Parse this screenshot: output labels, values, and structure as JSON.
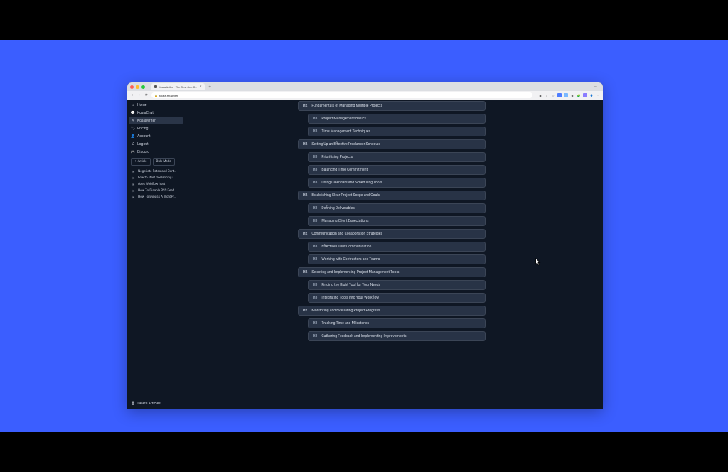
{
  "browser": {
    "tab_title": "KoalaWriter - The Best One-C…",
    "url": "koala.sh/writer"
  },
  "sidebar": {
    "nav": [
      {
        "icon": "home",
        "label": "Home"
      },
      {
        "icon": "chat",
        "label": "KoalaChat"
      },
      {
        "icon": "pen",
        "label": "KoalaWriter",
        "active": true
      },
      {
        "icon": "tag",
        "label": "Pricing"
      },
      {
        "icon": "user",
        "label": "Account"
      },
      {
        "icon": "logout",
        "label": "Logout"
      },
      {
        "icon": "discord",
        "label": "Discord"
      }
    ],
    "buttons": {
      "new_article": "Article",
      "bulk_mode": "Bulk Mode"
    },
    "articles": [
      "Negotiate Rates and Cont…",
      "how to start freelancing i…",
      "does Webflow host",
      "How To Disable RSS Feed…",
      "How To Bypass A WordPr…"
    ],
    "delete_label": "Delete Articles"
  },
  "outline": [
    {
      "level": "H2",
      "text": "Fundamentals of Managing Multiple Projects"
    },
    {
      "level": "H3",
      "text": "Project Management Basics"
    },
    {
      "level": "H3",
      "text": "Time Management Techniques"
    },
    {
      "level": "H2",
      "text": "Setting Up an Effective Freelancer Schedule"
    },
    {
      "level": "H3",
      "text": "Prioritising Projects"
    },
    {
      "level": "H3",
      "text": "Balancing Time Commitment"
    },
    {
      "level": "H3",
      "text": "Using Calendars and Scheduling Tools"
    },
    {
      "level": "H2",
      "text": "Establishing Clear Project Scope and Goals"
    },
    {
      "level": "H3",
      "text": "Defining Deliverables"
    },
    {
      "level": "H3",
      "text": "Managing Client Expectations"
    },
    {
      "level": "H2",
      "text": "Communication and Collaboration Strategies"
    },
    {
      "level": "H3",
      "text": "Effective Client Communication"
    },
    {
      "level": "H3",
      "text": "Working with Contractors and Teams"
    },
    {
      "level": "H2",
      "text": "Selecting and Implementing Project Management Tools"
    },
    {
      "level": "H3",
      "text": "Finding the Right Tool for Your Needs"
    },
    {
      "level": "H3",
      "text": "Integrating Tools Into Your Workflow"
    },
    {
      "level": "H2",
      "text": "Monitoring and Evaluating Project Progress"
    },
    {
      "level": "H3",
      "text": "Tracking Time and Milestones"
    },
    {
      "level": "H3",
      "text": "Gathering Feedback and Implementing Improvements"
    }
  ]
}
